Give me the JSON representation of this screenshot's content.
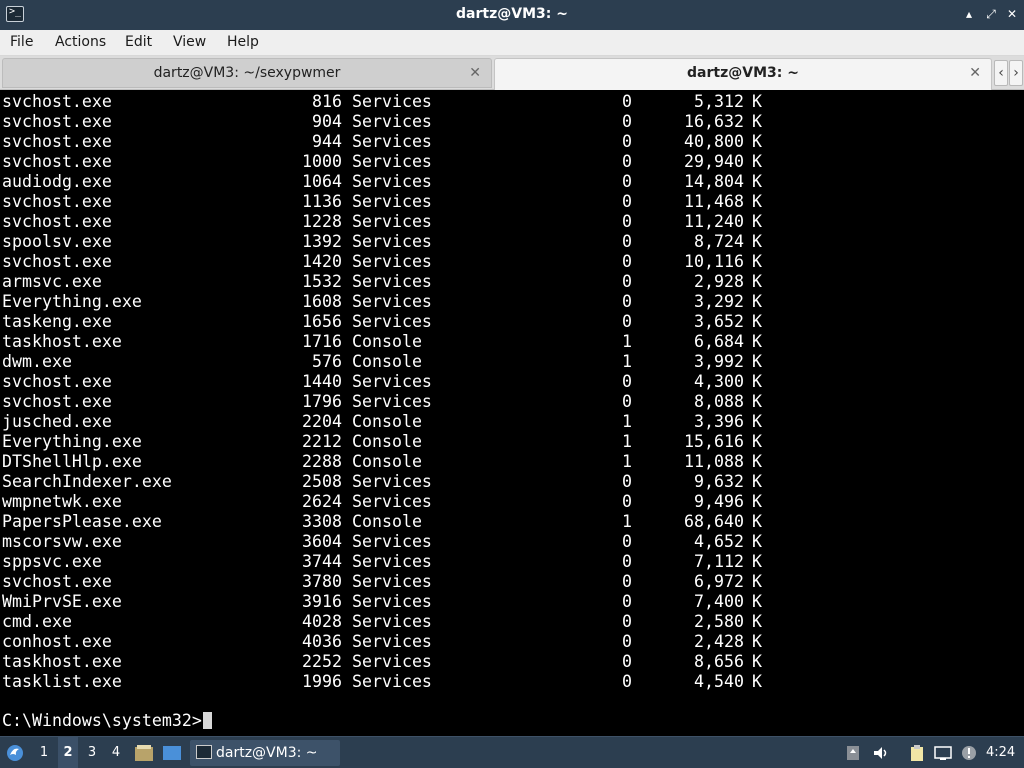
{
  "window": {
    "title": "dartz@VM3: ~",
    "minimize": "▴",
    "maximize": "⤢",
    "close": "✕"
  },
  "menu": [
    "File",
    "Actions",
    "Edit",
    "View",
    "Help"
  ],
  "tabs": [
    {
      "label": "dartz@VM3: ~/sexypwmer",
      "active": false
    },
    {
      "label": "dartz@VM3: ~",
      "active": true
    }
  ],
  "tab_nav": {
    "prev": "‹",
    "next": "›"
  },
  "terminal": {
    "rows": [
      {
        "image": "svchost.exe",
        "pid": "816",
        "session": "Services",
        "num": "0",
        "mem": "5,312",
        "unit": "K"
      },
      {
        "image": "svchost.exe",
        "pid": "904",
        "session": "Services",
        "num": "0",
        "mem": "16,632",
        "unit": "K"
      },
      {
        "image": "svchost.exe",
        "pid": "944",
        "session": "Services",
        "num": "0",
        "mem": "40,800",
        "unit": "K"
      },
      {
        "image": "svchost.exe",
        "pid": "1000",
        "session": "Services",
        "num": "0",
        "mem": "29,940",
        "unit": "K"
      },
      {
        "image": "audiodg.exe",
        "pid": "1064",
        "session": "Services",
        "num": "0",
        "mem": "14,804",
        "unit": "K"
      },
      {
        "image": "svchost.exe",
        "pid": "1136",
        "session": "Services",
        "num": "0",
        "mem": "11,468",
        "unit": "K"
      },
      {
        "image": "svchost.exe",
        "pid": "1228",
        "session": "Services",
        "num": "0",
        "mem": "11,240",
        "unit": "K"
      },
      {
        "image": "spoolsv.exe",
        "pid": "1392",
        "session": "Services",
        "num": "0",
        "mem": "8,724",
        "unit": "K"
      },
      {
        "image": "svchost.exe",
        "pid": "1420",
        "session": "Services",
        "num": "0",
        "mem": "10,116",
        "unit": "K"
      },
      {
        "image": "armsvc.exe",
        "pid": "1532",
        "session": "Services",
        "num": "0",
        "mem": "2,928",
        "unit": "K"
      },
      {
        "image": "Everything.exe",
        "pid": "1608",
        "session": "Services",
        "num": "0",
        "mem": "3,292",
        "unit": "K"
      },
      {
        "image": "taskeng.exe",
        "pid": "1656",
        "session": "Services",
        "num": "0",
        "mem": "3,652",
        "unit": "K"
      },
      {
        "image": "taskhost.exe",
        "pid": "1716",
        "session": "Console",
        "num": "1",
        "mem": "6,684",
        "unit": "K"
      },
      {
        "image": "dwm.exe",
        "pid": "576",
        "session": "Console",
        "num": "1",
        "mem": "3,992",
        "unit": "K"
      },
      {
        "image": "svchost.exe",
        "pid": "1440",
        "session": "Services",
        "num": "0",
        "mem": "4,300",
        "unit": "K"
      },
      {
        "image": "svchost.exe",
        "pid": "1796",
        "session": "Services",
        "num": "0",
        "mem": "8,088",
        "unit": "K"
      },
      {
        "image": "jusched.exe",
        "pid": "2204",
        "session": "Console",
        "num": "1",
        "mem": "3,396",
        "unit": "K"
      },
      {
        "image": "Everything.exe",
        "pid": "2212",
        "session": "Console",
        "num": "1",
        "mem": "15,616",
        "unit": "K"
      },
      {
        "image": "DTShellHlp.exe",
        "pid": "2288",
        "session": "Console",
        "num": "1",
        "mem": "11,088",
        "unit": "K"
      },
      {
        "image": "SearchIndexer.exe",
        "pid": "2508",
        "session": "Services",
        "num": "0",
        "mem": "9,632",
        "unit": "K"
      },
      {
        "image": "wmpnetwk.exe",
        "pid": "2624",
        "session": "Services",
        "num": "0",
        "mem": "9,496",
        "unit": "K"
      },
      {
        "image": "PapersPlease.exe",
        "pid": "3308",
        "session": "Console",
        "num": "1",
        "mem": "68,640",
        "unit": "K"
      },
      {
        "image": "mscorsvw.exe",
        "pid": "3604",
        "session": "Services",
        "num": "0",
        "mem": "4,652",
        "unit": "K"
      },
      {
        "image": "sppsvc.exe",
        "pid": "3744",
        "session": "Services",
        "num": "0",
        "mem": "7,112",
        "unit": "K"
      },
      {
        "image": "svchost.exe",
        "pid": "3780",
        "session": "Services",
        "num": "0",
        "mem": "6,972",
        "unit": "K"
      },
      {
        "image": "WmiPrvSE.exe",
        "pid": "3916",
        "session": "Services",
        "num": "0",
        "mem": "7,400",
        "unit": "K"
      },
      {
        "image": "cmd.exe",
        "pid": "4028",
        "session": "Services",
        "num": "0",
        "mem": "2,580",
        "unit": "K"
      },
      {
        "image": "conhost.exe",
        "pid": "4036",
        "session": "Services",
        "num": "0",
        "mem": "2,428",
        "unit": "K"
      },
      {
        "image": "taskhost.exe",
        "pid": "2252",
        "session": "Services",
        "num": "0",
        "mem": "8,656",
        "unit": "K"
      },
      {
        "image": "tasklist.exe",
        "pid": "1996",
        "session": "Services",
        "num": "0",
        "mem": "4,540",
        "unit": "K"
      }
    ],
    "prompt": "C:\\Windows\\system32>"
  },
  "taskbar": {
    "workspaces": [
      "1",
      "2",
      "3",
      "4"
    ],
    "active_workspace": "2",
    "task_label": "dartz@VM3: ~",
    "clock": "4:24",
    "icons": [
      "start-menu-icon",
      "file-manager-icon",
      "show-desktop-icon",
      "terminal-icon",
      "update-icon",
      "volume-icon",
      "clipboard-icon",
      "network-icon",
      "notification-icon"
    ]
  }
}
